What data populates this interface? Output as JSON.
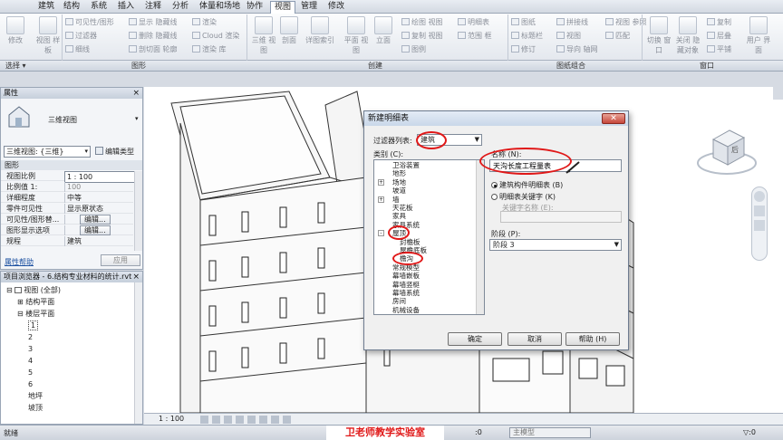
{
  "ribbon": {
    "tabs": [
      "建筑",
      "结构",
      "系统",
      "插入",
      "注释",
      "分析",
      "体量和场地",
      "协作",
      "视图",
      "管理",
      "修改"
    ],
    "active_tab": "视图",
    "groups": [
      "选择 ▾",
      "图形",
      "创建",
      "图纸组合",
      "窗口"
    ],
    "graphics_items": [
      "可见性/图形",
      "过滤器",
      "细线",
      "显示 隐藏线",
      "删除 隐藏线",
      "剖切面 轮廓",
      "渲染",
      "Cloud 渲染",
      "渲染 库"
    ],
    "left_buttons": [
      "修改",
      "视图 样板"
    ],
    "create_items": [
      "三维 视图",
      "剖面",
      "详图索引",
      "平面 视图",
      "立面",
      "绘图 视图",
      "复制 视图",
      "图例",
      "明细表",
      "范围 框"
    ],
    "sheet_items": [
      "图纸",
      "标题栏",
      "修订",
      "拼接线",
      "视图",
      "导向 轴网",
      "视图 参照",
      "匹配"
    ],
    "window_items": [
      "切换 窗口",
      "关闭 隐藏对象",
      "复制",
      "层叠",
      "平铺",
      "用户 界面"
    ]
  },
  "properties": {
    "title": "属性",
    "type_name": "三维视图",
    "selector": "三维视图: {三维}",
    "edit_type": "编辑类型",
    "section": "图形",
    "rows": [
      {
        "label": "视图比例",
        "value": "1 : 100"
      },
      {
        "label": "比例值 1:",
        "value": "100"
      },
      {
        "label": "详细程度",
        "value": "中等"
      },
      {
        "label": "零件可见性",
        "value": "显示原状态"
      },
      {
        "label": "可见性/图形替...",
        "value": "编辑..."
      },
      {
        "label": "图形显示选项",
        "value": "编辑..."
      },
      {
        "label": "规程",
        "value": "建筑"
      }
    ],
    "help": "属性帮助",
    "apply": "应用"
  },
  "browser": {
    "title": "项目浏览器 - 6.结构专业材料的统计.rvt",
    "items": [
      {
        "label": "视图 (全部)",
        "indent": 0,
        "tog": "⊟"
      },
      {
        "label": "结构平面",
        "indent": 1,
        "tog": "⊞"
      },
      {
        "label": "楼层平面",
        "indent": 1,
        "tog": "⊟"
      },
      {
        "label": "1",
        "indent": 2,
        "tog": ""
      },
      {
        "label": "2",
        "indent": 2,
        "tog": ""
      },
      {
        "label": "3",
        "indent": 2,
        "tog": ""
      },
      {
        "label": "4",
        "indent": 2,
        "tog": ""
      },
      {
        "label": "5",
        "indent": 2,
        "tog": ""
      },
      {
        "label": "6",
        "indent": 2,
        "tog": ""
      },
      {
        "label": "地坪",
        "indent": 2,
        "tog": ""
      },
      {
        "label": "坡顶",
        "indent": 2,
        "tog": ""
      }
    ]
  },
  "viewbar": {
    "scale": "1 : 100"
  },
  "status": {
    "left": "就绪",
    "watermark": "卫老师教学实验室",
    "zero": ":0",
    "model": "主模型"
  },
  "viewcube": {
    "face": "后"
  },
  "dialog": {
    "title": "新建明细表",
    "filter_label": "过滤器列表:",
    "filter_value": "建筑",
    "category_label": "类别 (C):",
    "categories": [
      {
        "label": "卫浴装置",
        "level": 0,
        "exp": ""
      },
      {
        "label": "地形",
        "level": 0,
        "exp": ""
      },
      {
        "label": "场地",
        "level": 0,
        "exp": "+"
      },
      {
        "label": "坡道",
        "level": 0,
        "exp": ""
      },
      {
        "label": "墙",
        "level": 0,
        "exp": "+"
      },
      {
        "label": "天花板",
        "level": 0,
        "exp": ""
      },
      {
        "label": "家具",
        "level": 0,
        "exp": ""
      },
      {
        "label": "家具系统",
        "level": 0,
        "exp": ""
      },
      {
        "label": "屋顶",
        "level": 0,
        "exp": "-"
      },
      {
        "label": "封檐板",
        "level": 1,
        "exp": ""
      },
      {
        "label": "屋檐底板",
        "level": 1,
        "exp": ""
      },
      {
        "label": "檐沟",
        "level": 1,
        "exp": ""
      },
      {
        "label": "常规模型",
        "level": 0,
        "exp": ""
      },
      {
        "label": "幕墙嵌板",
        "level": 0,
        "exp": ""
      },
      {
        "label": "幕墙竖梃",
        "level": 0,
        "exp": ""
      },
      {
        "label": "幕墙系统",
        "level": 0,
        "exp": ""
      },
      {
        "label": "房间",
        "level": 0,
        "exp": ""
      },
      {
        "label": "机械设备",
        "level": 0,
        "exp": ""
      }
    ],
    "name_label": "名称 (N):",
    "name_value": "天沟长度工程量表",
    "radio_schedule": "建筑构件明细表 (B)",
    "radio_key": "明细表关键字 (K)",
    "key_name_label": "关键字名称 (E):",
    "phase_label": "阶段 (P):",
    "phase_value": "阶段 3",
    "ok": "确定",
    "cancel": "取消",
    "help": "帮助 (H)"
  }
}
